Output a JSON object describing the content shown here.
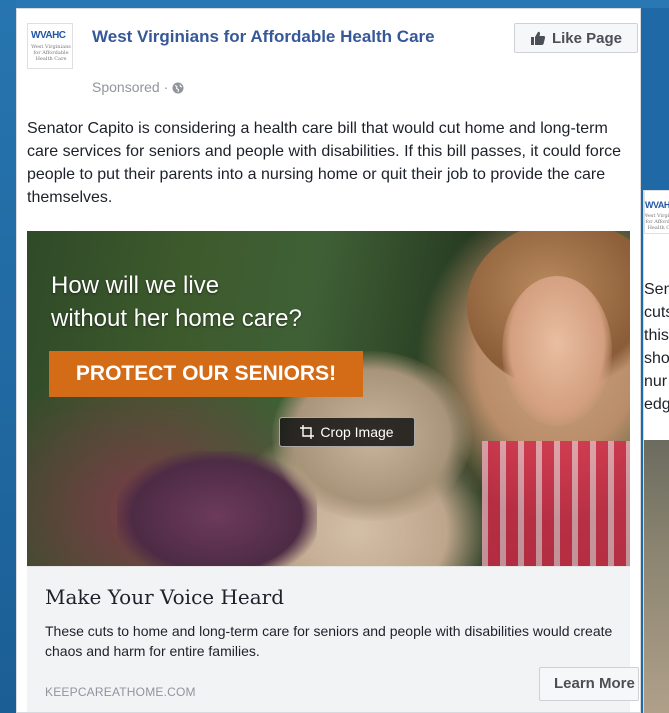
{
  "post": {
    "page_name": "West Virginians for Affordable Health Care",
    "logo_abbr": "WVAHC",
    "logo_sub": "West Virginians for Affordable Health Care",
    "sponsored": "Sponsored ·",
    "like_button": "Like Page",
    "text": "Senator Capito is considering a health care bill that would cut home and long-term care services for seniors and people with disabilities. If this bill passes, it could force people to put their parents into a nursing home or quit their job to provide the care themselves.",
    "image": {
      "headline_line1": "How will we live",
      "headline_line2": "without her home care?",
      "banner": "PROTECT OUR SENIORS!",
      "crop_button": "Crop Image"
    },
    "link": {
      "title": "Make Your Voice Heard",
      "description": "These cuts to home and long-term care for seniors and people with disabilities would create chaos and harm for entire families.",
      "domain": "KEEPCAREATHOME.COM",
      "cta": "Learn More"
    }
  },
  "second_post": {
    "logo_abbr": "WVAHC",
    "lines": [
      "Senator",
      "cuts",
      "this",
      "sho",
      "nur",
      "edg"
    ]
  },
  "colors": {
    "background": "#1f6aa6",
    "link": "#365899",
    "banner": "#d36b17"
  }
}
